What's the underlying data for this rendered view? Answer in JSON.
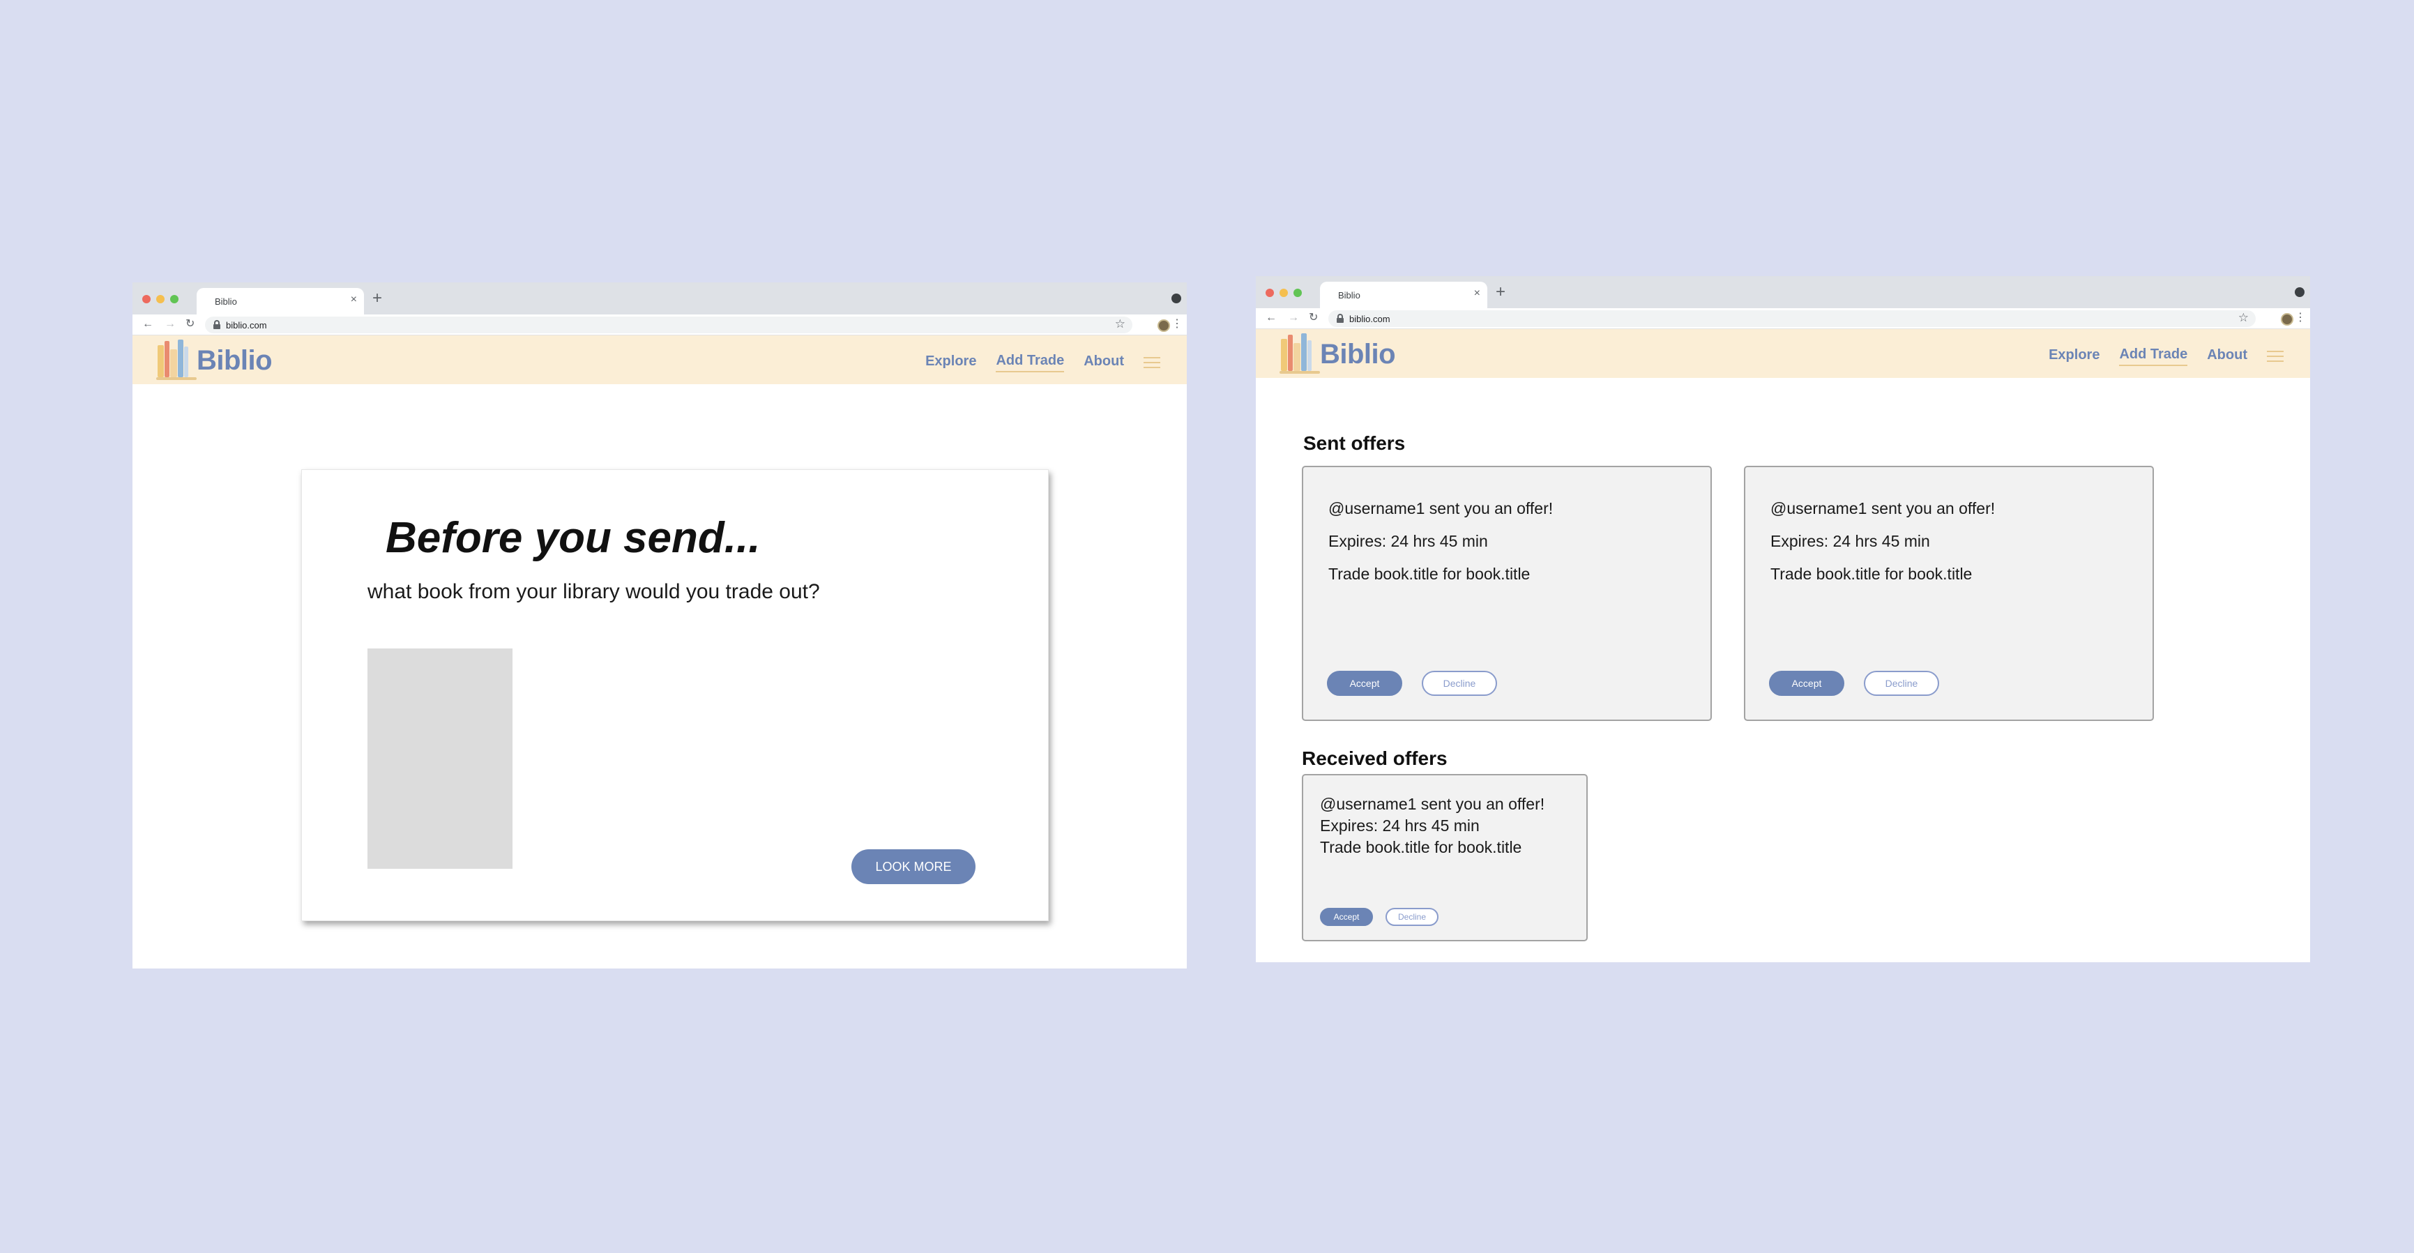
{
  "colors": {
    "page_background": "#d9ddf1",
    "header_background": "#fbeed6",
    "brand_blue": "#6b84b5",
    "accent_gold": "#e8c98f",
    "card_background": "#f2f2f2",
    "placeholder_gray": "#dcdcdc"
  },
  "browser": {
    "tab_title": "Biblio",
    "url": "biblio.com",
    "icons": [
      "back-arrow-icon",
      "forward-arrow-icon",
      "reload-icon",
      "lock-icon",
      "star-icon",
      "profile-avatar",
      "kebab-menu-icon",
      "close-icon",
      "plus-icon"
    ]
  },
  "site": {
    "brand": "Biblio",
    "nav": {
      "explore": "Explore",
      "add_trade": "Add Trade",
      "about": "About"
    },
    "active_nav": "Add Trade"
  },
  "screen_before_send": {
    "title": "Before you send...",
    "subtitle": "what book from your library would you trade out?",
    "look_more_label": "LOOK MORE"
  },
  "screen_offers": {
    "sent_title": "Sent offers",
    "received_title": "Received offers",
    "sent_offers": [
      {
        "message": "@username1 sent you an offer!",
        "expires": "Expires: 24 hrs 45 min",
        "trade": "Trade book.title for book.title",
        "accept_label": "Accept",
        "decline_label": "Decline"
      },
      {
        "message": "@username1 sent you an offer!",
        "expires": "Expires: 24 hrs 45 min",
        "trade": "Trade book.title for book.title",
        "accept_label": "Accept",
        "decline_label": "Decline"
      }
    ],
    "received_offers": [
      {
        "message": "@username1 sent you an offer!",
        "expires": "Expires: 24 hrs 45 min",
        "trade": "Trade book.title for book.title",
        "accept_label": "Accept",
        "decline_label": "Decline"
      }
    ]
  }
}
